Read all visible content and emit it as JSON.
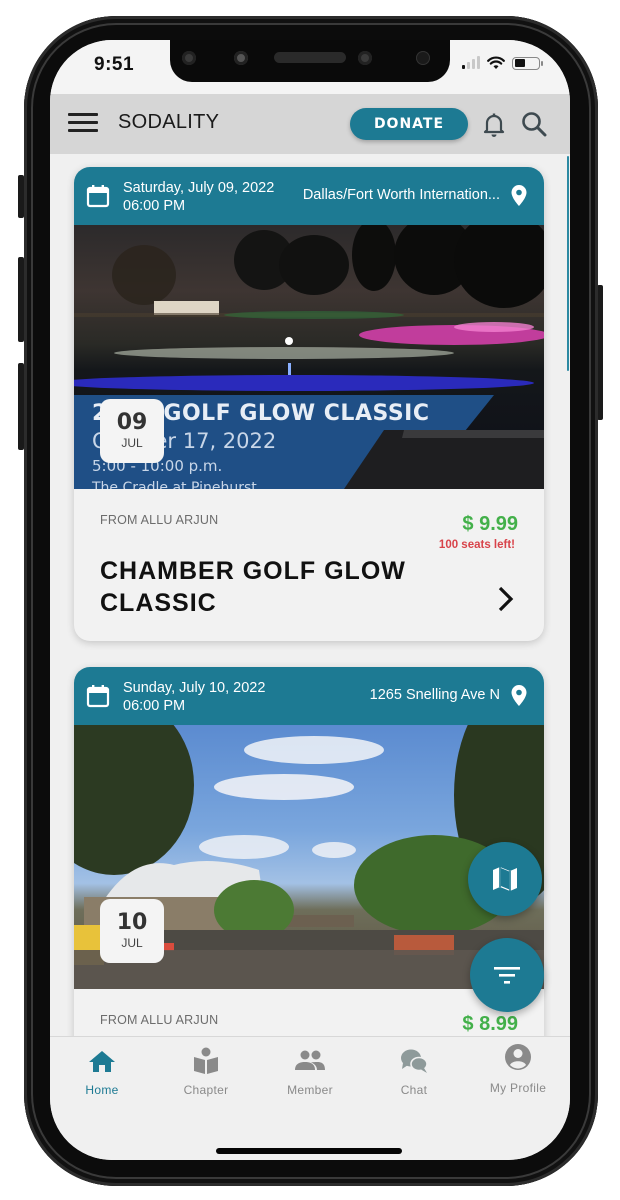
{
  "status_bar": {
    "time": "9:51",
    "battery_level": 0.45
  },
  "app_bar": {
    "title": "SODALITY",
    "donate_label": "DONATE",
    "icons": [
      "menu-icon",
      "bell-icon",
      "search-icon"
    ]
  },
  "events": [
    {
      "date": "Saturday, July 09, 2022",
      "time": "06:00 PM",
      "location": "Dallas/Fort Worth Internation...",
      "badge_day": "09",
      "badge_month": "JUL",
      "from": "FROM ALLU ARJUN",
      "price": "$ 9.99",
      "seats": "100 seats left!",
      "title": "CHAMBER GOLF GLOW CLASSIC",
      "image_text": {
        "line1": "2022 GOLF GLOW CLASSIC",
        "line2": "October 17, 2022",
        "line3": "5:00 - 10:00 p.m.",
        "line4": "The Cradle at Pinehurst"
      }
    },
    {
      "date": "Sunday, July 10, 2022",
      "time": "06:00 PM",
      "location": "1265 Snelling Ave N",
      "badge_day": "10",
      "badge_month": "JUL",
      "from": "FROM ALLU ARJUN",
      "price": "$ 8.99"
    }
  ],
  "fabs": {
    "map": "map-icon",
    "filter": "filter-icon"
  },
  "bottom_nav": [
    {
      "label": "Home",
      "icon": "home-icon",
      "active": true
    },
    {
      "label": "Chapter",
      "icon": "chapter-icon",
      "active": false
    },
    {
      "label": "Member",
      "icon": "members-icon",
      "active": false
    },
    {
      "label": "Chat",
      "icon": "chat-icon",
      "active": false
    },
    {
      "label": "My Profile",
      "icon": "profile-icon",
      "active": false
    }
  ],
  "colors": {
    "primary": "#1d7a93",
    "price": "#43b04a",
    "seats": "#d8434a",
    "appbar": "#d6d6d6"
  }
}
